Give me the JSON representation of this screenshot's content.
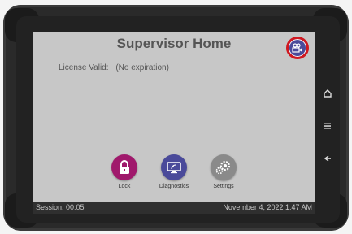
{
  "screen": {
    "title": "Supervisor Home",
    "license_label": "License Valid:",
    "license_value": "(No expiration)"
  },
  "camera_button": {
    "icon": "video-camera-icon",
    "highlight_color": "#d01820"
  },
  "apps": [
    {
      "label": "Lock",
      "icon": "padlock-icon",
      "color": "#a0196c"
    },
    {
      "label": "Diagnostics",
      "icon": "monitor-icon",
      "color": "#4a4a9a"
    },
    {
      "label": "Settings",
      "icon": "gears-icon",
      "color": "#8a8a8a"
    }
  ],
  "status_bar": {
    "session": "Session: 00:05",
    "datetime": "November 4, 2022 1:47 AM"
  },
  "device_nav": [
    "home-icon",
    "menu-icon",
    "back-icon"
  ]
}
